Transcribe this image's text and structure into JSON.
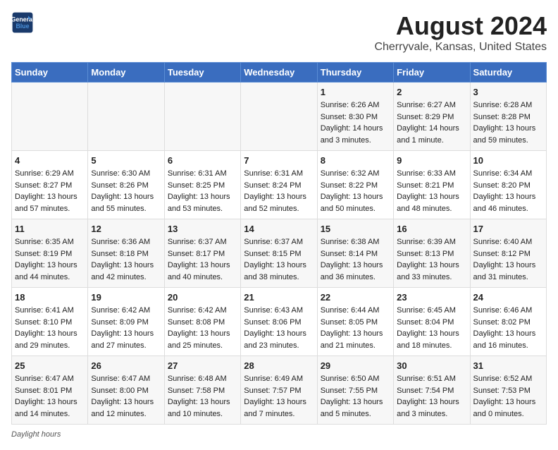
{
  "header": {
    "logo_line1": "General",
    "logo_line2": "Blue",
    "title": "August 2024",
    "subtitle": "Cherryvale, Kansas, United States"
  },
  "days_of_week": [
    "Sunday",
    "Monday",
    "Tuesday",
    "Wednesday",
    "Thursday",
    "Friday",
    "Saturday"
  ],
  "weeks": [
    [
      {
        "day": "",
        "info": ""
      },
      {
        "day": "",
        "info": ""
      },
      {
        "day": "",
        "info": ""
      },
      {
        "day": "",
        "info": ""
      },
      {
        "day": "1",
        "info": "Sunrise: 6:26 AM\nSunset: 8:30 PM\nDaylight: 14 hours\nand 3 minutes."
      },
      {
        "day": "2",
        "info": "Sunrise: 6:27 AM\nSunset: 8:29 PM\nDaylight: 14 hours\nand 1 minute."
      },
      {
        "day": "3",
        "info": "Sunrise: 6:28 AM\nSunset: 8:28 PM\nDaylight: 13 hours\nand 59 minutes."
      }
    ],
    [
      {
        "day": "4",
        "info": "Sunrise: 6:29 AM\nSunset: 8:27 PM\nDaylight: 13 hours\nand 57 minutes."
      },
      {
        "day": "5",
        "info": "Sunrise: 6:30 AM\nSunset: 8:26 PM\nDaylight: 13 hours\nand 55 minutes."
      },
      {
        "day": "6",
        "info": "Sunrise: 6:31 AM\nSunset: 8:25 PM\nDaylight: 13 hours\nand 53 minutes."
      },
      {
        "day": "7",
        "info": "Sunrise: 6:31 AM\nSunset: 8:24 PM\nDaylight: 13 hours\nand 52 minutes."
      },
      {
        "day": "8",
        "info": "Sunrise: 6:32 AM\nSunset: 8:22 PM\nDaylight: 13 hours\nand 50 minutes."
      },
      {
        "day": "9",
        "info": "Sunrise: 6:33 AM\nSunset: 8:21 PM\nDaylight: 13 hours\nand 48 minutes."
      },
      {
        "day": "10",
        "info": "Sunrise: 6:34 AM\nSunset: 8:20 PM\nDaylight: 13 hours\nand 46 minutes."
      }
    ],
    [
      {
        "day": "11",
        "info": "Sunrise: 6:35 AM\nSunset: 8:19 PM\nDaylight: 13 hours\nand 44 minutes."
      },
      {
        "day": "12",
        "info": "Sunrise: 6:36 AM\nSunset: 8:18 PM\nDaylight: 13 hours\nand 42 minutes."
      },
      {
        "day": "13",
        "info": "Sunrise: 6:37 AM\nSunset: 8:17 PM\nDaylight: 13 hours\nand 40 minutes."
      },
      {
        "day": "14",
        "info": "Sunrise: 6:37 AM\nSunset: 8:15 PM\nDaylight: 13 hours\nand 38 minutes."
      },
      {
        "day": "15",
        "info": "Sunrise: 6:38 AM\nSunset: 8:14 PM\nDaylight: 13 hours\nand 36 minutes."
      },
      {
        "day": "16",
        "info": "Sunrise: 6:39 AM\nSunset: 8:13 PM\nDaylight: 13 hours\nand 33 minutes."
      },
      {
        "day": "17",
        "info": "Sunrise: 6:40 AM\nSunset: 8:12 PM\nDaylight: 13 hours\nand 31 minutes."
      }
    ],
    [
      {
        "day": "18",
        "info": "Sunrise: 6:41 AM\nSunset: 8:10 PM\nDaylight: 13 hours\nand 29 minutes."
      },
      {
        "day": "19",
        "info": "Sunrise: 6:42 AM\nSunset: 8:09 PM\nDaylight: 13 hours\nand 27 minutes."
      },
      {
        "day": "20",
        "info": "Sunrise: 6:42 AM\nSunset: 8:08 PM\nDaylight: 13 hours\nand 25 minutes."
      },
      {
        "day": "21",
        "info": "Sunrise: 6:43 AM\nSunset: 8:06 PM\nDaylight: 13 hours\nand 23 minutes."
      },
      {
        "day": "22",
        "info": "Sunrise: 6:44 AM\nSunset: 8:05 PM\nDaylight: 13 hours\nand 21 minutes."
      },
      {
        "day": "23",
        "info": "Sunrise: 6:45 AM\nSunset: 8:04 PM\nDaylight: 13 hours\nand 18 minutes."
      },
      {
        "day": "24",
        "info": "Sunrise: 6:46 AM\nSunset: 8:02 PM\nDaylight: 13 hours\nand 16 minutes."
      }
    ],
    [
      {
        "day": "25",
        "info": "Sunrise: 6:47 AM\nSunset: 8:01 PM\nDaylight: 13 hours\nand 14 minutes."
      },
      {
        "day": "26",
        "info": "Sunrise: 6:47 AM\nSunset: 8:00 PM\nDaylight: 13 hours\nand 12 minutes."
      },
      {
        "day": "27",
        "info": "Sunrise: 6:48 AM\nSunset: 7:58 PM\nDaylight: 13 hours\nand 10 minutes."
      },
      {
        "day": "28",
        "info": "Sunrise: 6:49 AM\nSunset: 7:57 PM\nDaylight: 13 hours\nand 7 minutes."
      },
      {
        "day": "29",
        "info": "Sunrise: 6:50 AM\nSunset: 7:55 PM\nDaylight: 13 hours\nand 5 minutes."
      },
      {
        "day": "30",
        "info": "Sunrise: 6:51 AM\nSunset: 7:54 PM\nDaylight: 13 hours\nand 3 minutes."
      },
      {
        "day": "31",
        "info": "Sunrise: 6:52 AM\nSunset: 7:53 PM\nDaylight: 13 hours\nand 0 minutes."
      }
    ]
  ],
  "note": "Daylight hours"
}
